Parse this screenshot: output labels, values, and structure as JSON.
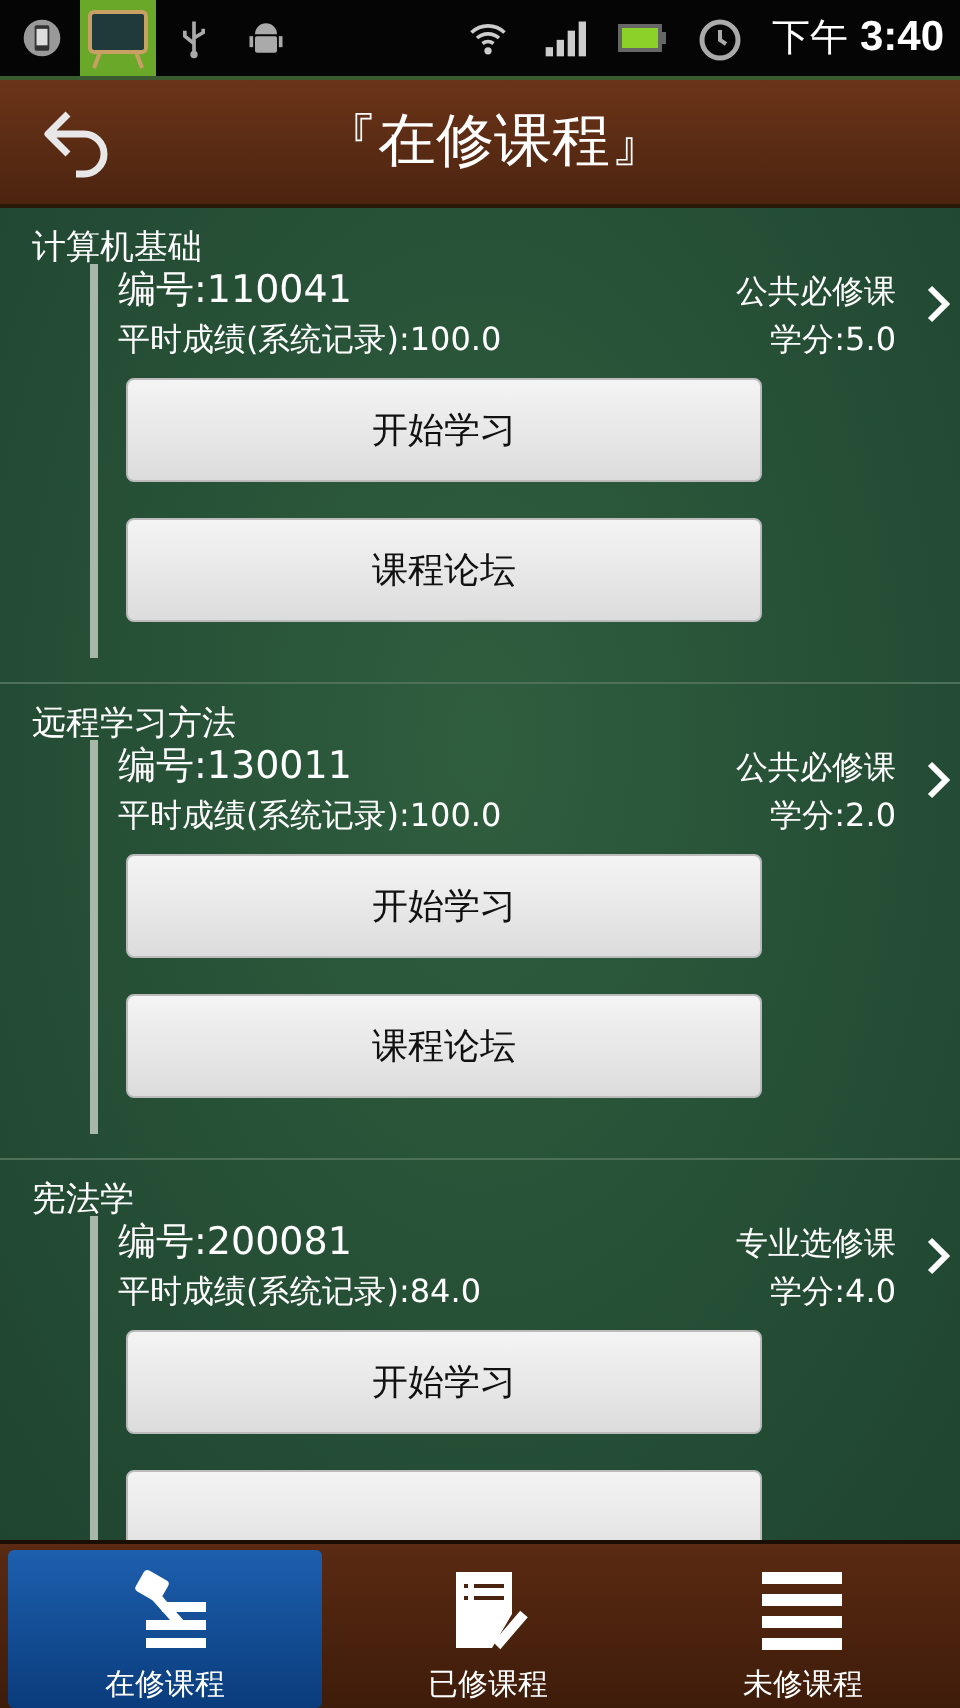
{
  "status_bar": {
    "time_prefix": "下午",
    "time": "3:40"
  },
  "header": {
    "title": "『在修课程』"
  },
  "courses": [
    {
      "name": "计算机基础",
      "code": "编号:110041",
      "type": "公共必修课",
      "grade": "平时成绩(系统记录):100.0",
      "credit": "学分:5.0",
      "buttons": [
        {
          "label": "开始学习"
        },
        {
          "label": "课程论坛"
        }
      ]
    },
    {
      "name": "远程学习方法",
      "code": "编号:130011",
      "type": "公共必修课",
      "grade": "平时成绩(系统记录):100.0",
      "credit": "学分:2.0",
      "buttons": [
        {
          "label": "开始学习"
        },
        {
          "label": "课程论坛"
        }
      ]
    },
    {
      "name": "宪法学",
      "code": "编号:200081",
      "type": "专业选修课",
      "grade": "平时成绩(系统记录):84.0",
      "credit": "学分:4.0",
      "buttons": [
        {
          "label": "开始学习"
        },
        {
          "kind": "cut"
        }
      ]
    }
  ],
  "tabs": [
    {
      "label": "在修课程",
      "selected": true
    },
    {
      "label": "已修课程",
      "selected": false
    },
    {
      "label": "未修课程",
      "selected": false
    }
  ]
}
